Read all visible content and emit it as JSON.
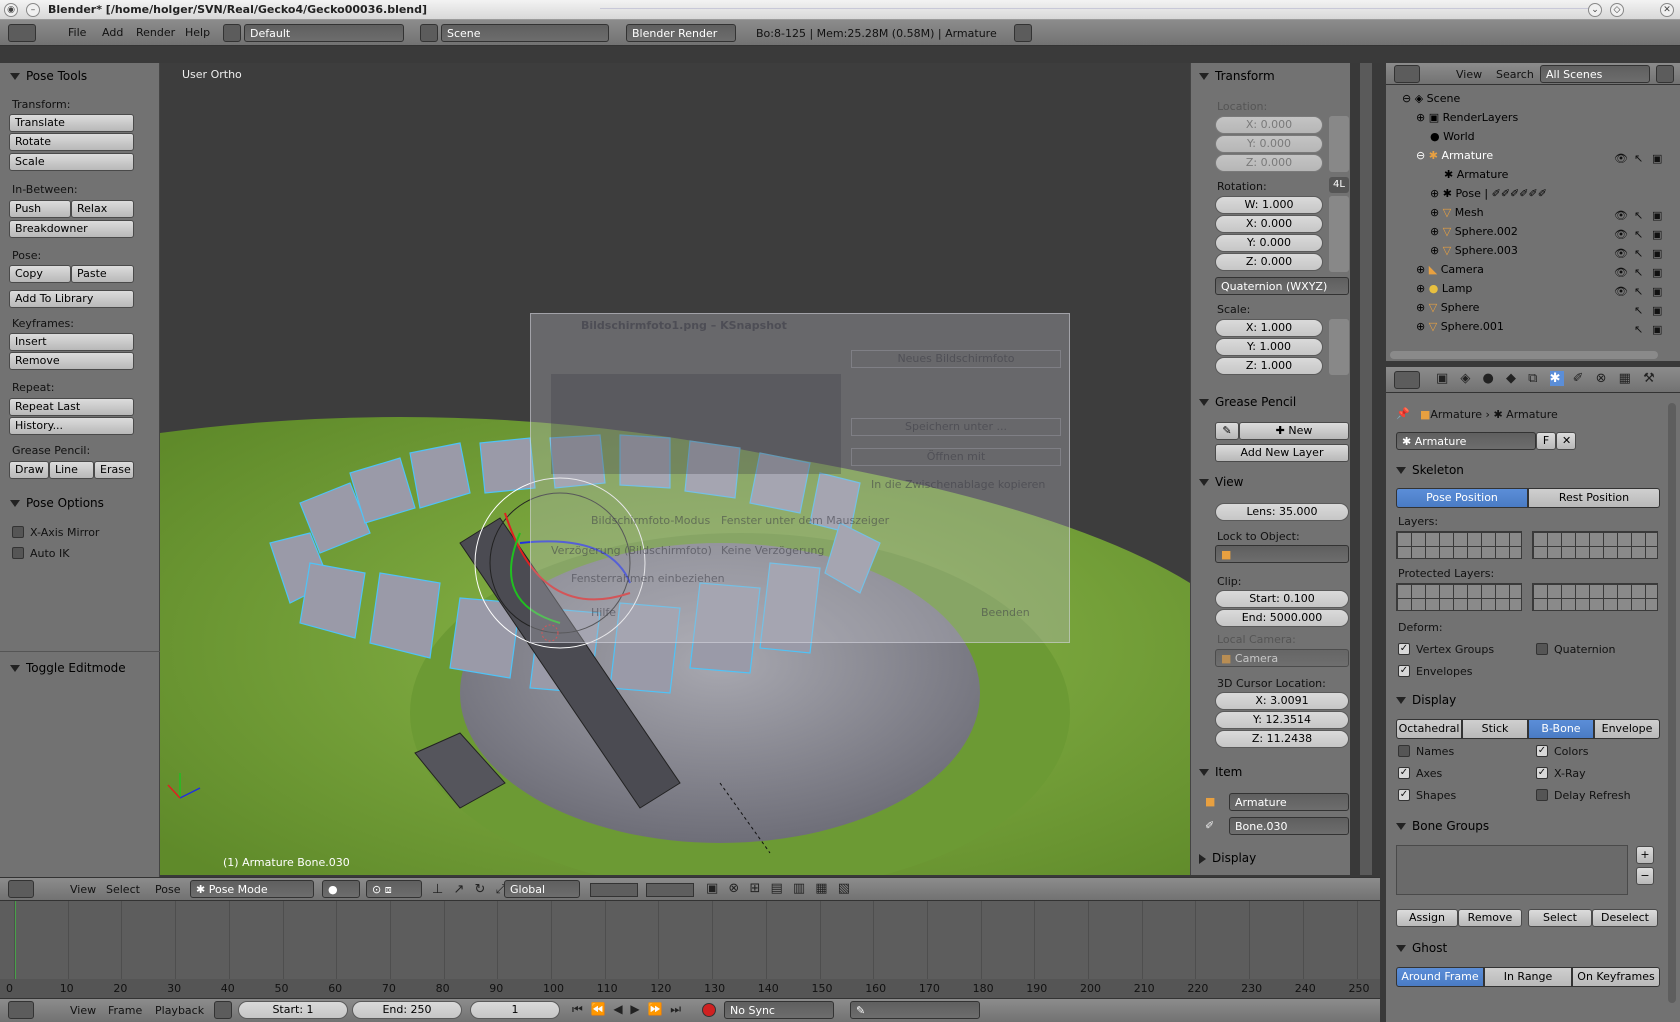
{
  "window_title": "Blender* [/home/holger/SVN/Real/Gecko4/Gecko00036.blend]",
  "topbar": {
    "menus": [
      "File",
      "Add",
      "Render",
      "Help"
    ],
    "layout": "Default",
    "scene": "Scene",
    "engine": "Blender Render",
    "stats": "Bo:8-125  | Mem:25.28M (0.58M) | Armature"
  },
  "toolshelf": {
    "panel_title": "Pose Tools",
    "transform_label": "Transform:",
    "translate": "Translate",
    "rotate": "Rotate",
    "scale": "Scale",
    "inbetween_label": "In-Between:",
    "push": "Push",
    "relax": "Relax",
    "breakdowner": "Breakdowner",
    "pose_label": "Pose:",
    "copy": "Copy",
    "paste": "Paste",
    "add_library": "Add To Library",
    "keyframes_label": "Keyframes:",
    "insert": "Insert",
    "remove": "Remove",
    "repeat_label": "Repeat:",
    "repeat_last": "Repeat Last",
    "history": "History...",
    "grease_label": "Grease Pencil:",
    "draw": "Draw",
    "line": "Line",
    "erase": "Erase",
    "pose_options": "Pose Options",
    "xaxis_mirror": "X-Axis Mirror",
    "auto_ik": "Auto IK",
    "toggle_editmode": "Toggle Editmode"
  },
  "viewport": {
    "view_label": "User Ortho",
    "object_label": "(1) Armature Bone.030",
    "ghost_window": {
      "title": "Bildschirmfoto1.png – KSnapshot",
      "new_shot": "Neues Bildschirmfoto",
      "save_as": "Speichern unter ...",
      "open_with": "Öffnen mit",
      "copy_clip": "In die Zwischenablage kopieren",
      "mode": "Bildschirmfoto-Modus",
      "mode_val": "Fenster unter dem Mauszeiger",
      "delay": "Verzögerung (Bildschirmfoto)",
      "delay_val": "Keine Verzögerung",
      "include": "Fensterrahmen einbeziehen",
      "help": "Hilfe",
      "quit": "Beenden"
    }
  },
  "props": {
    "transform": "Transform",
    "location": "Location:",
    "loc": [
      "X: 0.000",
      "Y: 0.000",
      "Z: 0.000"
    ],
    "rotation": "Rotation:",
    "rot_badge": "4L",
    "rot": [
      "W: 1.000",
      "X: 0.000",
      "Y: 0.000",
      "Z: 0.000"
    ],
    "rot_mode": "Quaternion (WXYZ)",
    "scale": "Scale:",
    "scl": [
      "X: 1.000",
      "Y: 1.000",
      "Z: 1.000"
    ],
    "grease_pencil": "Grease Pencil",
    "new": "New",
    "add_layer": "Add New Layer",
    "view": "View",
    "lens": "Lens: 35.000",
    "lock_obj": "Lock to Object:",
    "clip": "Clip:",
    "clip_start": "Start: 0.100",
    "clip_end": "End: 5000.000",
    "local_cam": "Local Camera:",
    "camera": "Camera",
    "cursor_loc": "3D Cursor Location:",
    "cursor": [
      "X: 3.0091",
      "Y: 12.3514",
      "Z: 11.2438"
    ],
    "item": "Item",
    "item_obj": "Armature",
    "item_bone": "Bone.030",
    "display": "Display"
  },
  "outliner": {
    "view": "View",
    "search": "Search",
    "filter": "All Scenes",
    "items": [
      "Scene",
      "RenderLayers",
      "World",
      "Armature",
      "Armature",
      "Pose",
      "Mesh",
      "Sphere.002",
      "Sphere.003",
      "Camera",
      "Lamp",
      "Sphere",
      "Sphere.001"
    ]
  },
  "propedit": {
    "breadcrumb1": "Armature",
    "breadcrumb2": "Armature",
    "datablock": "Armature",
    "fake": "F",
    "skeleton": "Skeleton",
    "pose_position": "Pose Position",
    "rest_position": "Rest Position",
    "layers": "Layers:",
    "protected_layers": "Protected Layers:",
    "deform": "Deform:",
    "vertex_groups": "Vertex Groups",
    "quaternion": "Quaternion",
    "envelopes": "Envelopes",
    "display": "Display",
    "octahedral": "Octahedral",
    "stick": "Stick",
    "bbone": "B-Bone",
    "envelope": "Envelope",
    "names": "Names",
    "colors": "Colors",
    "axes": "Axes",
    "xray": "X-Ray",
    "shapes": "Shapes",
    "delay_refresh": "Delay Refresh",
    "bone_groups": "Bone Groups",
    "assign": "Assign",
    "remove": "Remove",
    "select": "Select",
    "deselect": "Deselect",
    "ghost": "Ghost",
    "around_frame": "Around Frame",
    "in_range": "In Range",
    "on_keyframes": "On Keyframes"
  },
  "viewheader": {
    "view": "View",
    "select": "Select",
    "pose": "Pose",
    "mode": "Pose Mode",
    "orientation": "Global"
  },
  "timeline": {
    "ticks": [
      "0",
      "10",
      "20",
      "30",
      "40",
      "50",
      "60",
      "70",
      "80",
      "90",
      "100",
      "110",
      "120",
      "130",
      "140",
      "150",
      "160",
      "170",
      "180",
      "190",
      "200",
      "210",
      "220",
      "230",
      "240",
      "250"
    ],
    "view": "View",
    "frame": "Frame",
    "playback": "Playback",
    "start": "Start: 1",
    "end": "End: 250",
    "current": "1",
    "sync": "No Sync"
  },
  "colors": {
    "accent_blue": "#5b8ed8",
    "ground_green": "#7ba33a",
    "bone_outline": "#4fc3f7"
  }
}
